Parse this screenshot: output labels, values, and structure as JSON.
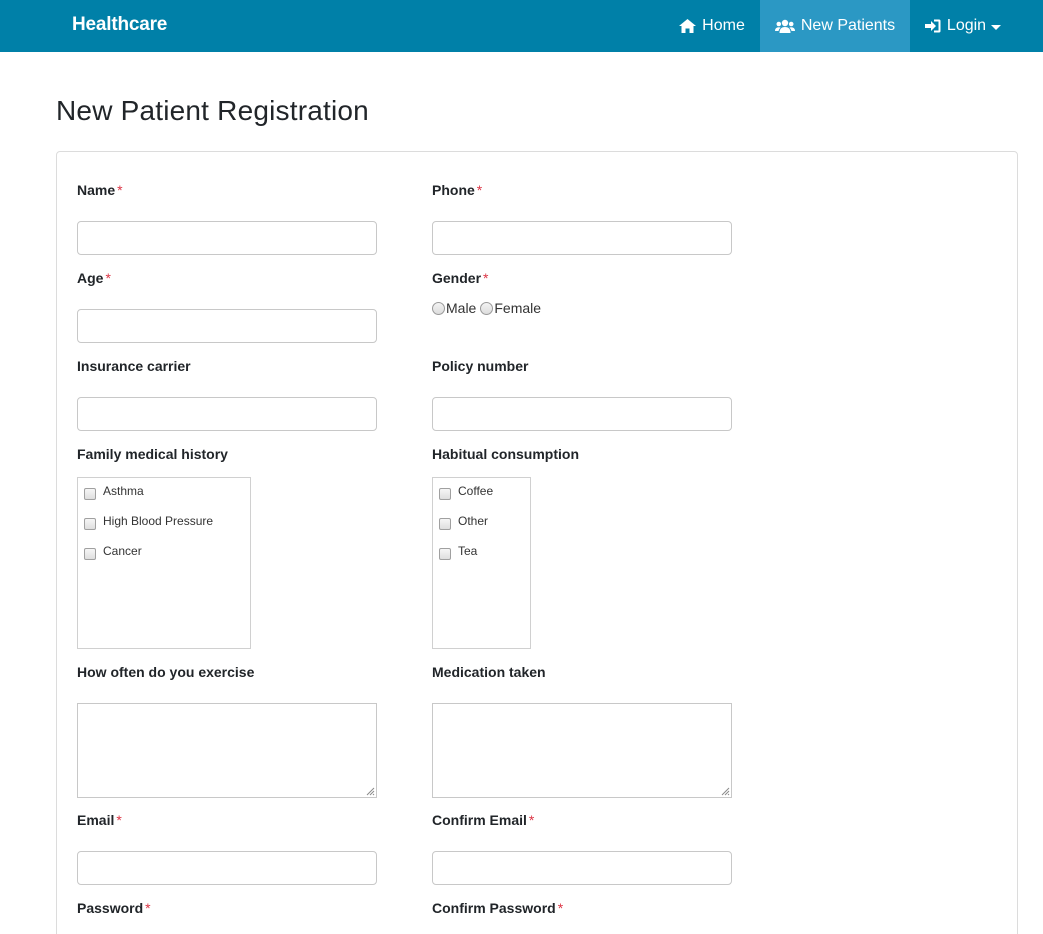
{
  "navbar": {
    "brand": "Healthcare",
    "items": [
      {
        "label": "Home",
        "icon": "home-icon",
        "active": false
      },
      {
        "label": "New Patients",
        "icon": "users-icon",
        "active": true
      },
      {
        "label": "Login",
        "icon": "sign-in-icon",
        "active": false,
        "dropdown": true
      }
    ],
    "bg_color": "#0080a8",
    "active_color": "#2b98c4"
  },
  "page": {
    "title": "New Patient Registration"
  },
  "form": {
    "required_marker": "*",
    "name": {
      "label": "Name",
      "value": ""
    },
    "phone": {
      "label": "Phone",
      "value": ""
    },
    "age": {
      "label": "Age",
      "value": ""
    },
    "gender": {
      "label": "Gender",
      "options": [
        "Male",
        "Female"
      ],
      "selected": null
    },
    "insurance_carrier": {
      "label": "Insurance carrier",
      "value": ""
    },
    "policy_number": {
      "label": "Policy number",
      "value": ""
    },
    "family_history": {
      "label": "Family medical history",
      "options": [
        "Asthma",
        "High Blood Pressure",
        "Cancer"
      ]
    },
    "habitual": {
      "label": "Habitual consumption",
      "options": [
        "Coffee",
        "Other",
        "Tea"
      ]
    },
    "exercise": {
      "label": "How often do you exercise",
      "value": ""
    },
    "medication": {
      "label": "Medication taken",
      "value": ""
    },
    "email": {
      "label": "Email",
      "value": ""
    },
    "confirm_email": {
      "label": "Confirm Email",
      "value": ""
    },
    "password": {
      "label": "Password"
    },
    "confirm_password": {
      "label": "Confirm Password"
    }
  }
}
